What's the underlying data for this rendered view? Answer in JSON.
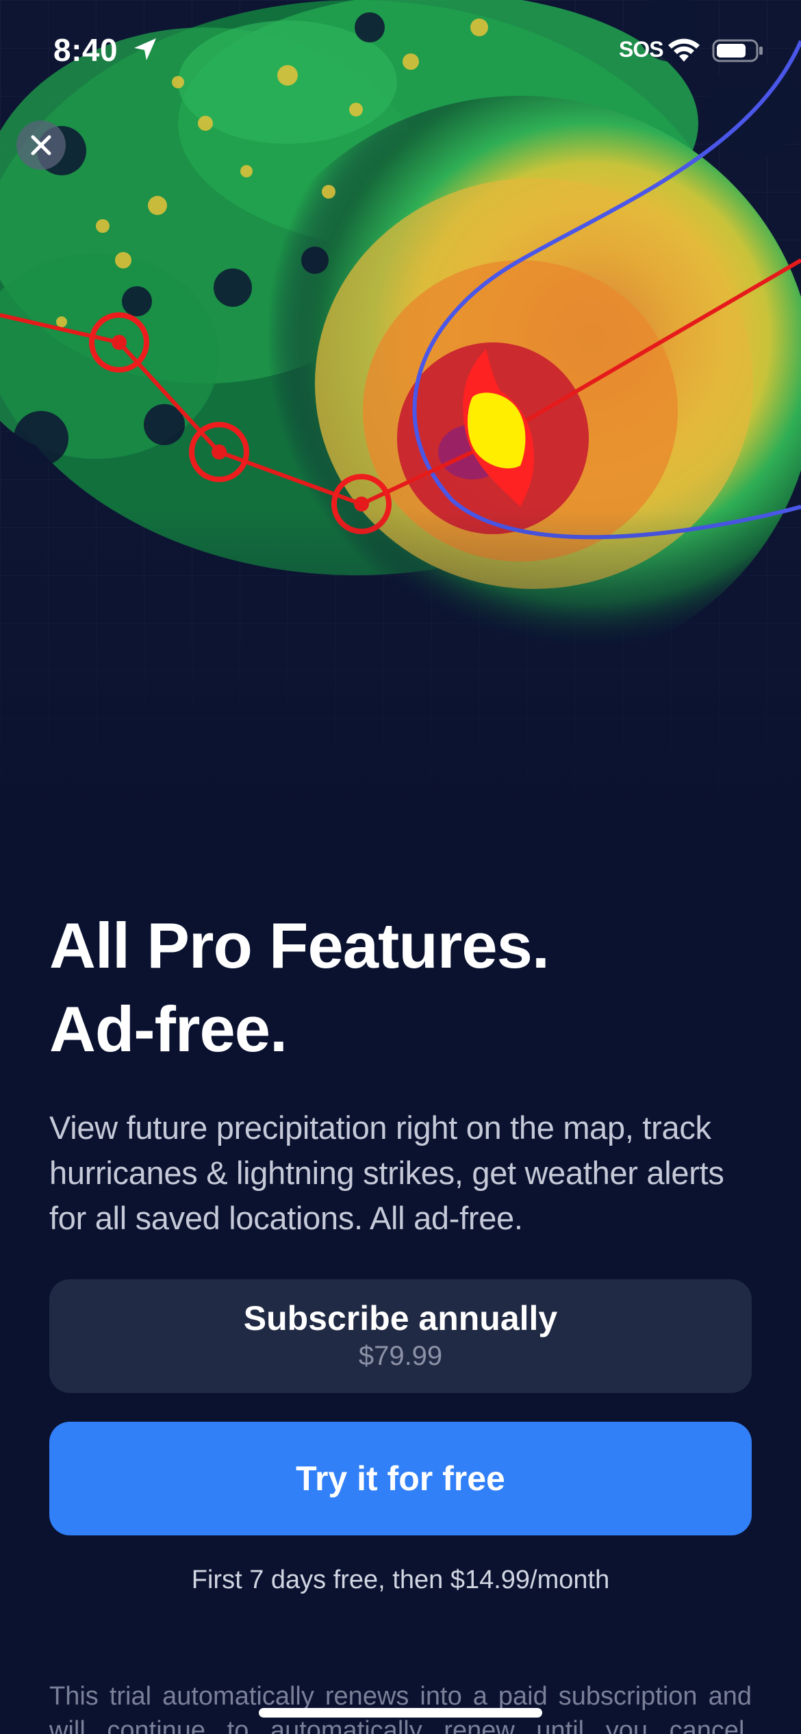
{
  "status_bar": {
    "time": "8:40",
    "sos": "SOS",
    "icons": [
      "location-arrow-icon",
      "wifi-icon",
      "battery-icon"
    ]
  },
  "close_icon": "close-icon",
  "map": {
    "icons": [
      "hurricane-icon",
      "track-point-icon"
    ],
    "colors": {
      "track": "#e51b1b",
      "cone": "#4a57e8",
      "hurricane_outer": "#ff2222",
      "hurricane_inner": "#ffee00"
    }
  },
  "headline": {
    "line1": "All Pro Features.",
    "line2": "Ad-free."
  },
  "description": "View future precipitation right on the map, track hurricanes & lightning strikes, get weather alerts for all saved locations. All ad-free.",
  "subscribe": {
    "label": "Subscribe annually",
    "price": "$79.99"
  },
  "trial": {
    "label": "Try it for free",
    "note": "First 7 days free, then $14.99/month"
  },
  "legal": "This trial automatically renews into a paid subscription and will continue to automatically renew until you cancel.",
  "colors": {
    "background": "#0b1230",
    "primary_button": "#3180f8",
    "secondary_button": "#212a44"
  }
}
